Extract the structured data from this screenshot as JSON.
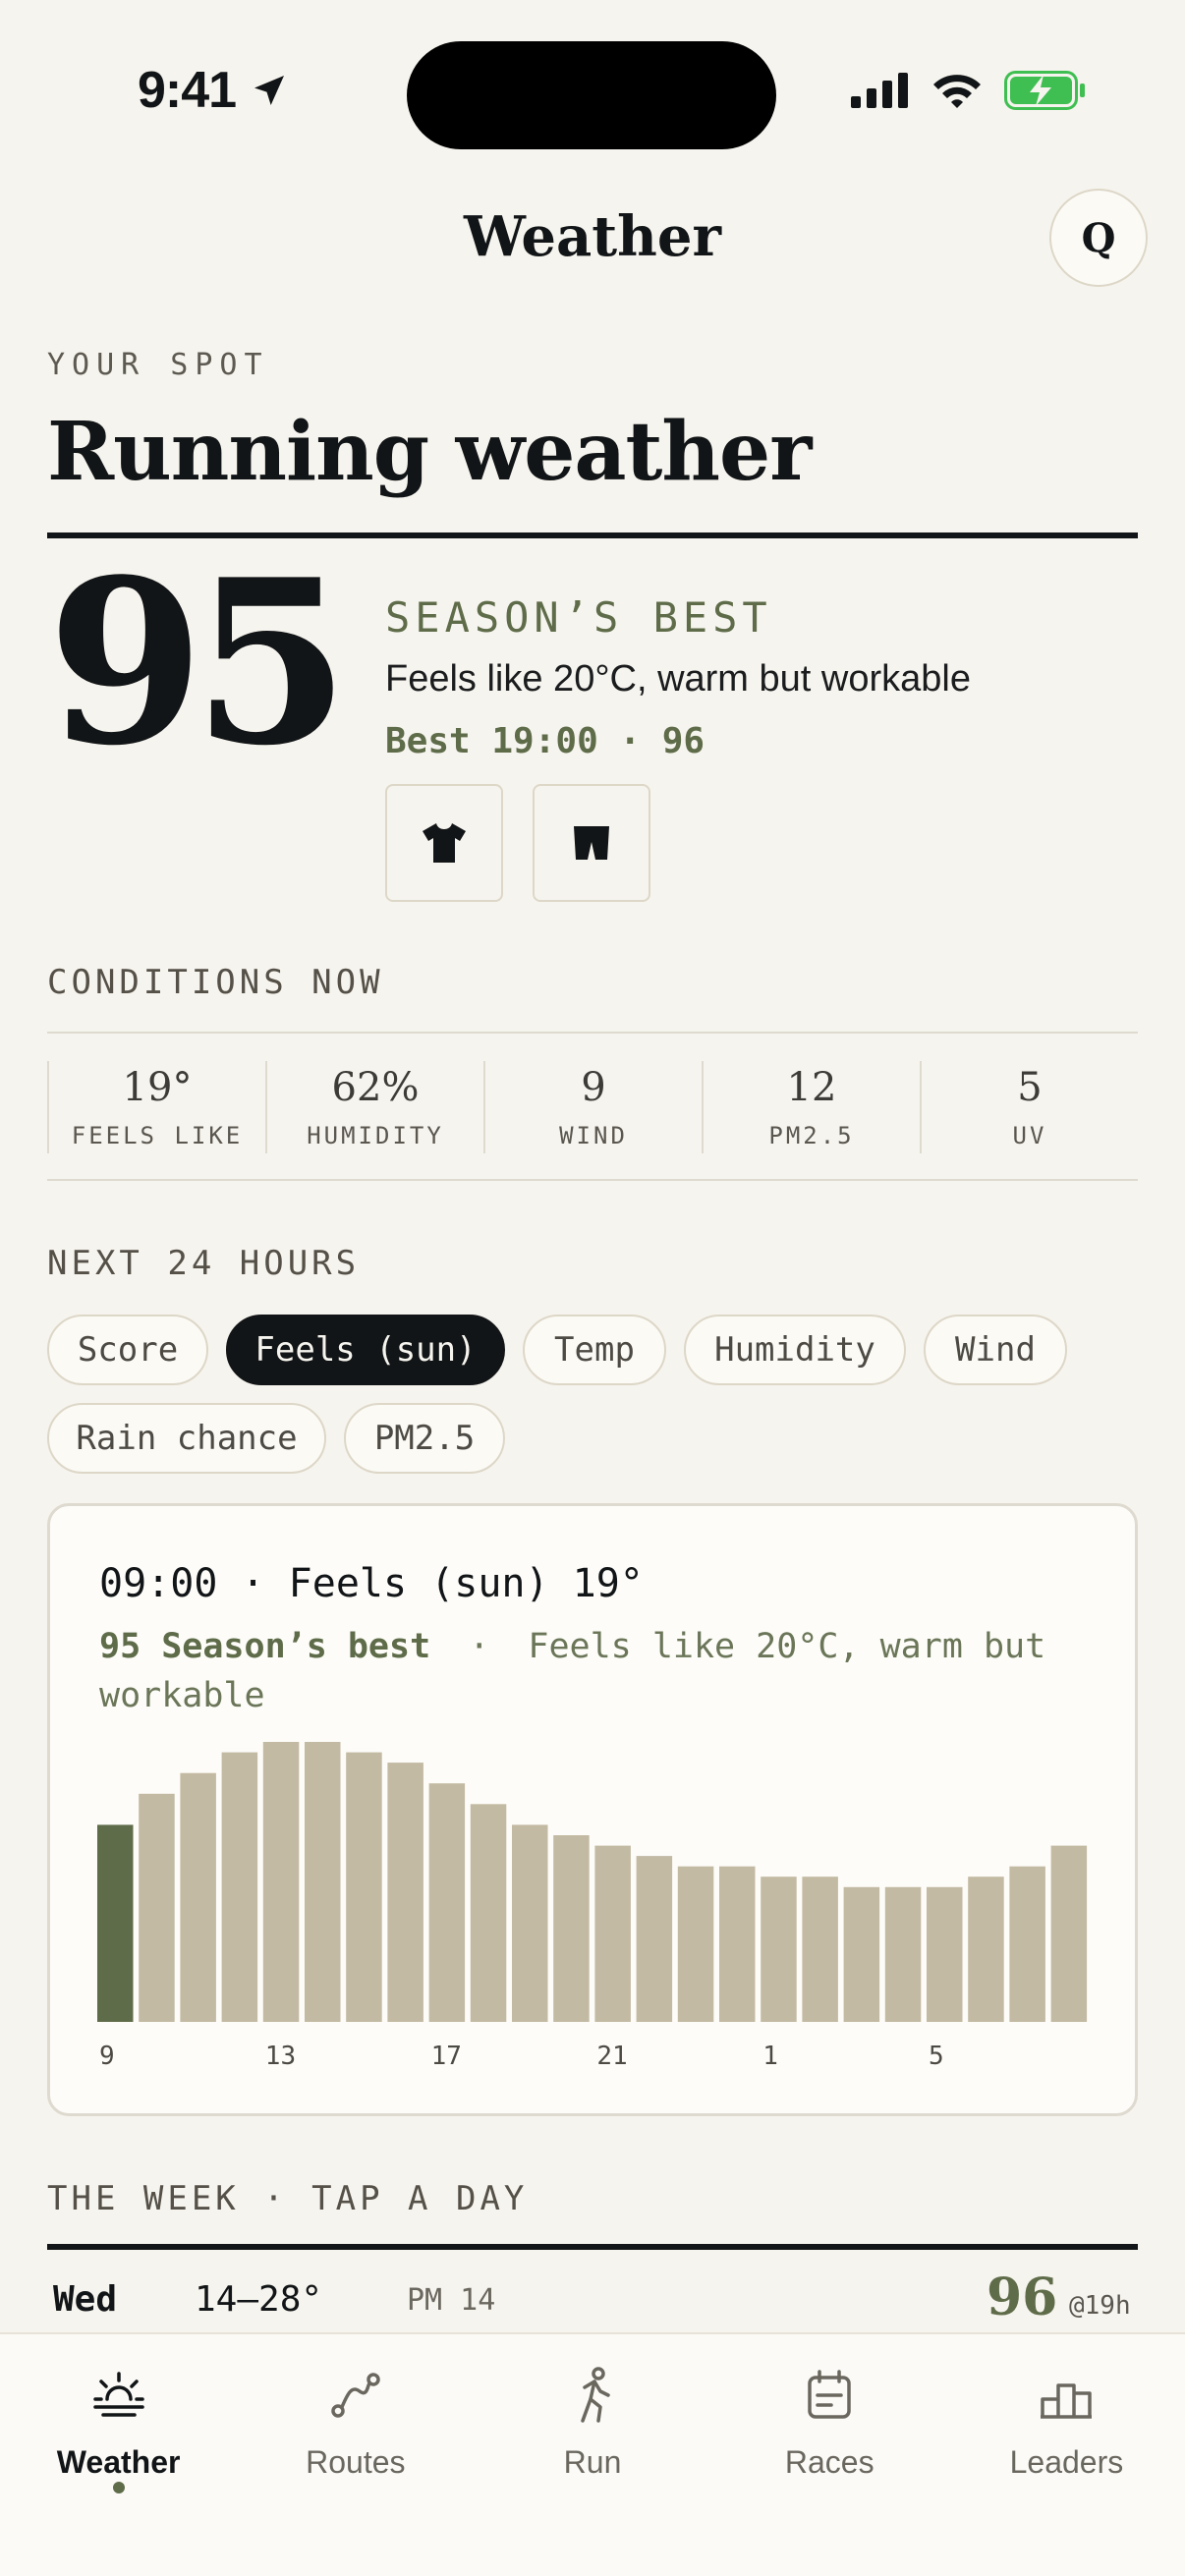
{
  "status": {
    "time": "9:41"
  },
  "header": {
    "title": "Weather",
    "profile_initial": "Q"
  },
  "hero": {
    "eyebrow": "YOUR SPOT",
    "title": "Running weather",
    "score": "95",
    "best_label": "SEASON’S BEST",
    "description": "Feels like 20°C, warm but workable",
    "best_time": "Best 19:00 · 96",
    "gear": [
      "tshirt-icon",
      "shorts-icon"
    ]
  },
  "conditions": {
    "label": "CONDITIONS NOW",
    "items": [
      {
        "value": "19°",
        "label": "FEELS LIKE"
      },
      {
        "value": "62%",
        "label": "HUMIDITY"
      },
      {
        "value": "9",
        "label": "WIND"
      },
      {
        "value": "12",
        "label": "PM2.5"
      },
      {
        "value": "5",
        "label": "UV"
      }
    ]
  },
  "next24": {
    "label": "NEXT 24 HOURS",
    "chips": [
      "Score",
      "Feels (sun)",
      "Temp",
      "Humidity",
      "Wind",
      "Rain chance",
      "PM2.5"
    ],
    "active_chip": "Feels (sun)"
  },
  "card": {
    "heading": "09:00 · Feels (sun) 19°",
    "sub_bold": "95 Season’s best",
    "sub_sep": "·",
    "sub_rest": "Feels like 20°C, warm but workable"
  },
  "chart_data": {
    "type": "bar",
    "categories": [
      "9",
      "10",
      "11",
      "12",
      "13",
      "14",
      "15",
      "16",
      "17",
      "18",
      "19",
      "20",
      "21",
      "22",
      "23",
      "0",
      "1",
      "2",
      "3",
      "4",
      "5",
      "6",
      "7",
      "8"
    ],
    "tick_labels": [
      "9",
      "13",
      "17",
      "21",
      "1",
      "5"
    ],
    "values": [
      19,
      22,
      24,
      26,
      27,
      27,
      26,
      25,
      23,
      21,
      19,
      18,
      17,
      16,
      15,
      15,
      14,
      14,
      13,
      13,
      13,
      14,
      15,
      17
    ],
    "highlight_index": 0,
    "ylim": [
      0,
      27
    ],
    "colors": {
      "highlight": "#5f6c4a",
      "bar": "#c3baa3"
    },
    "grid": false
  },
  "week": {
    "label": "THE WEEK · TAP A DAY",
    "rows": [
      {
        "day": "Wed",
        "range": "14–28°",
        "pm": "PM 14",
        "score": "96",
        "at": "@19h"
      }
    ]
  },
  "tabs": [
    {
      "label": "Weather",
      "icon": "sun-horizon-icon",
      "active": true
    },
    {
      "label": "Routes",
      "icon": "route-icon",
      "active": false
    },
    {
      "label": "Run",
      "icon": "runner-icon",
      "active": false
    },
    {
      "label": "Races",
      "icon": "calendar-icon",
      "active": false
    },
    {
      "label": "Leaders",
      "icon": "podium-icon",
      "active": false
    }
  ],
  "colors": {
    "accent": "#5f6c4a",
    "ink": "#121517",
    "background": "#f6f4ee"
  }
}
